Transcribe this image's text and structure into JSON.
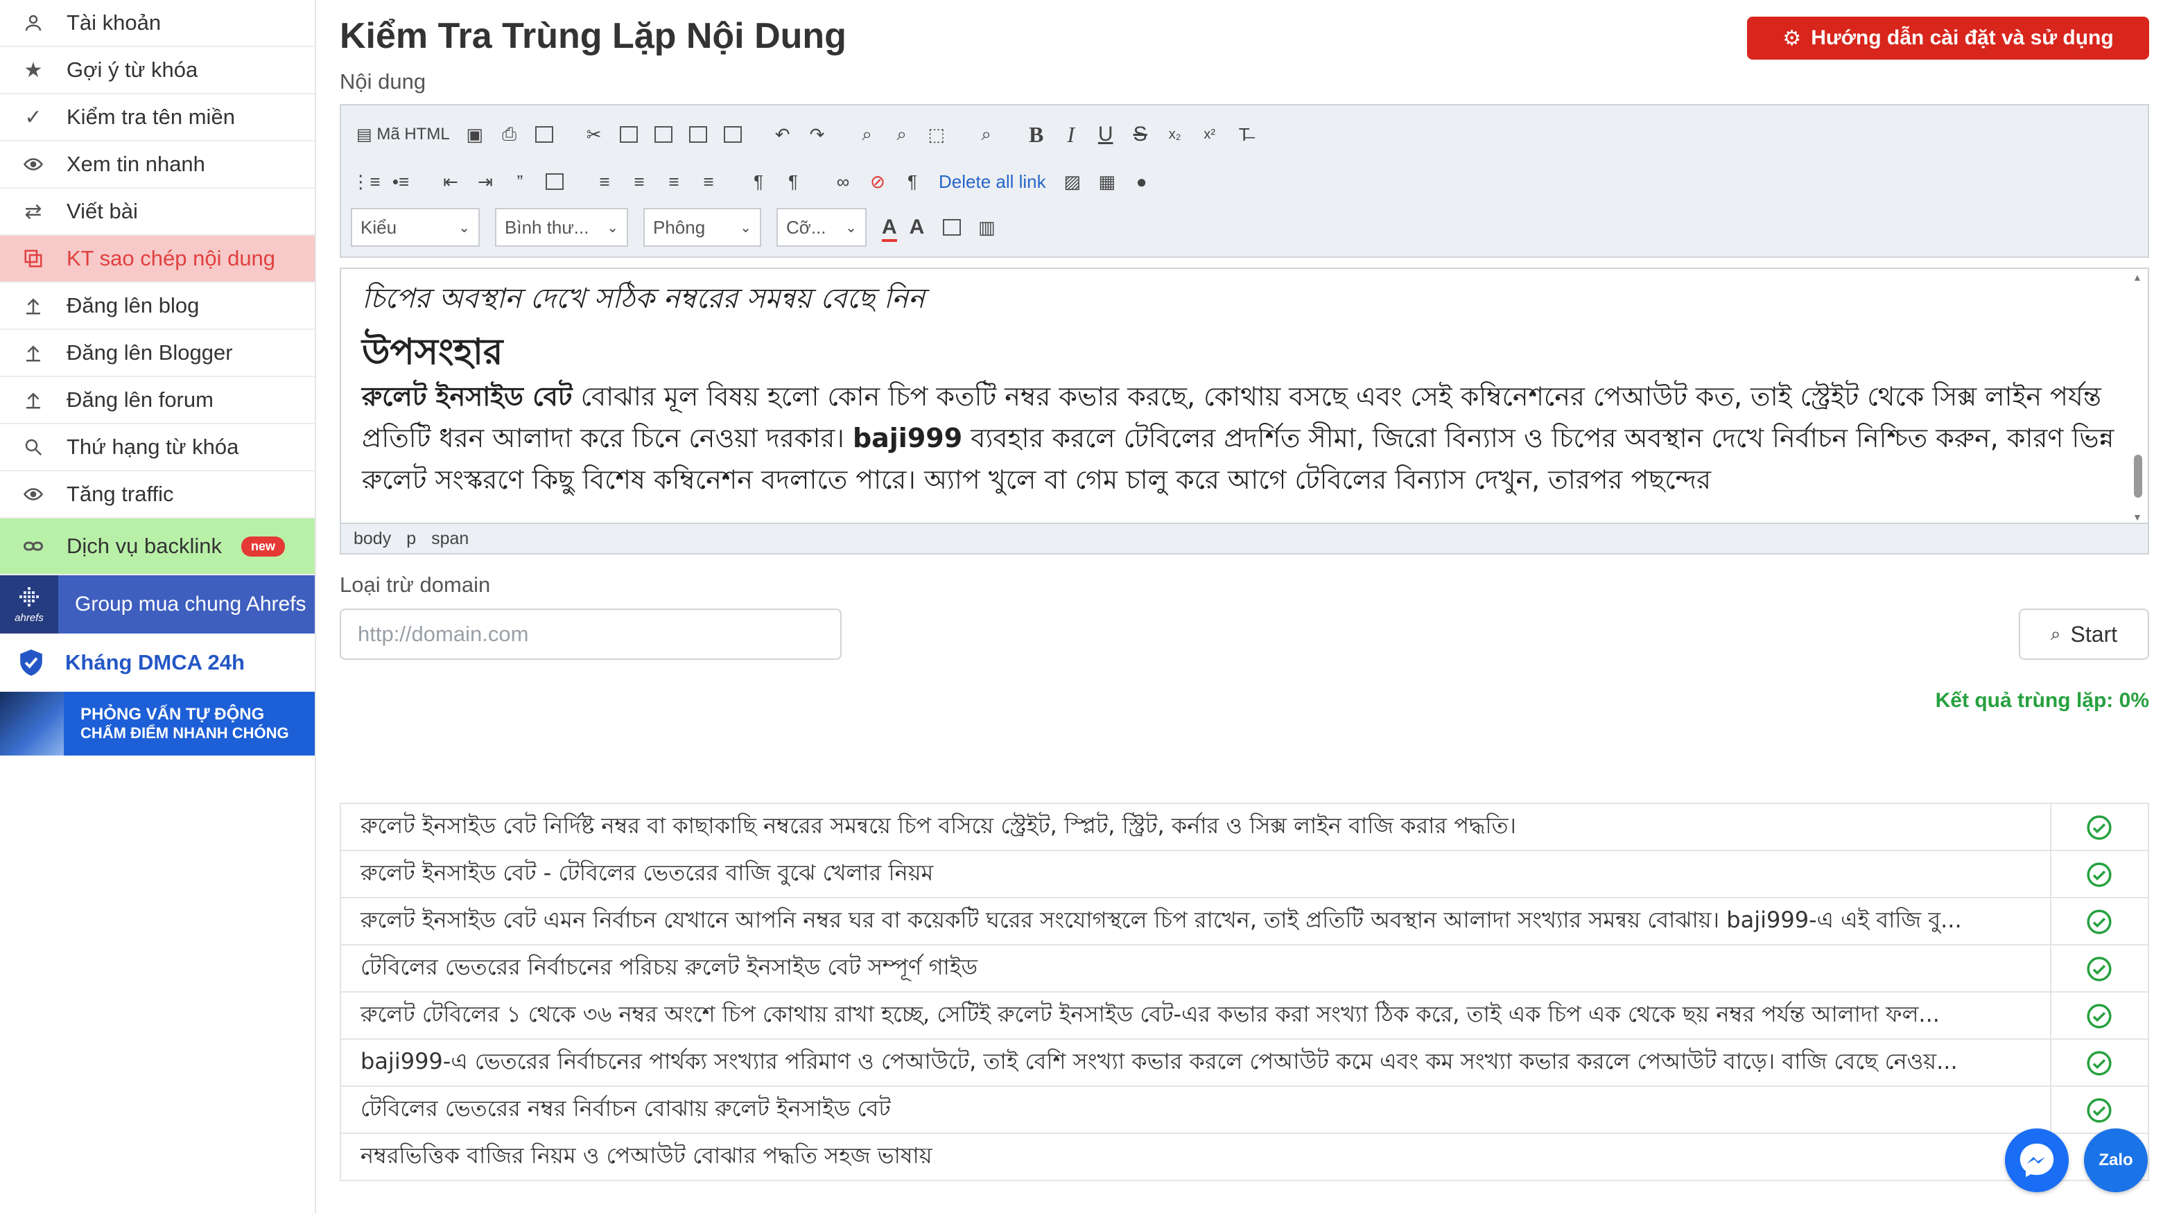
{
  "sidebar": {
    "items": [
      {
        "label": "Tài khoản",
        "icon": "user-icon"
      },
      {
        "label": "Gợi ý từ khóa",
        "icon": "star-icon"
      },
      {
        "label": "Kiểm tra tên miền",
        "icon": "check-icon"
      },
      {
        "label": "Xem tin nhanh",
        "icon": "eye-icon"
      },
      {
        "label": "Viết bài",
        "icon": "swap-icon"
      },
      {
        "label": "KT sao chép nội dung",
        "icon": "copy-icon",
        "active": true
      },
      {
        "label": "Đăng lên blog",
        "icon": "upload-icon"
      },
      {
        "label": "Đăng lên Blogger",
        "icon": "upload-icon"
      },
      {
        "label": "Đăng lên forum",
        "icon": "upload-icon"
      },
      {
        "label": "Thứ hạng từ khóa",
        "icon": "search-icon"
      },
      {
        "label": "Tăng traffic",
        "icon": "eye-icon"
      }
    ],
    "backlink": {
      "label": "Dịch vụ backlink",
      "badge": "new",
      "icon": "link-icon"
    },
    "ahrefs": {
      "logo_text": "ahrefs",
      "label": "Group mua chung Ahrefs"
    },
    "dmca": {
      "label": "Kháng DMCA 24h"
    },
    "interview": {
      "line1": "PHỎNG VẤN TỰ ĐỘNG",
      "line2": "CHẤM ĐIỂM NHANH CHÓNG"
    }
  },
  "header": {
    "title": "Kiểm Tra Trùng Lặp Nội Dung",
    "guide_button": "Hướng dẫn cài đặt và sử dụng"
  },
  "editor": {
    "label": "Nội dung",
    "toolbar": {
      "source_label": "Mã HTML",
      "delete_links_label": "Delete all link",
      "format_select": "Kiểu",
      "paragraph_select": "Bình thư...",
      "font_select": "Phông",
      "size_select": "Cỡ..."
    },
    "content": {
      "line1": "চিপের অবস্থান দেখে সঠিক নম্বরের সমন্বয় বেছে নিন",
      "heading": "উপসংহার",
      "para_bold": "রুলেট ইনসাইড বেট",
      "para_rest": " বোঝার মূল বিষয় হলো কোন চিপ কতটি নম্বর কভার করছে, কোথায় বসছে এবং সেই কম্বিনেশনের পেআউট কত, তাই স্ট্রেইট থেকে সিক্স লাইন পর্যন্ত প্রতিটি ধরন আলাদা করে চিনে নেওয়া দরকার। ",
      "para_bold2": "baji999",
      "para_rest2": " ব্যবহার করলে টেবিলের প্রদর্শিত সীমা, জিরো বিন্যাস ও চিপের অবস্থান দেখে নির্বাচন নিশ্চিত করুন, কারণ ভিন্ন রুলেট সংস্করণে কিছু বিশেষ কম্বিনেশন বদলাতে পারে। অ্যাপ খুলে বা গেম চালু করে আগে টেবিলের বিন্যাস দেখুন, তারপর পছন্দের"
    },
    "path": [
      "body",
      "p",
      "span"
    ]
  },
  "exclude": {
    "label": "Loại trừ domain",
    "placeholder": "http://domain.com",
    "start_button": "Start"
  },
  "result": {
    "text": "Kết quả trùng lặp: 0%"
  },
  "results": [
    {
      "text": "রুলেট ইনসাইড বেট নির্দিষ্ট নম্বর বা কাছাকাছি নম্বরের সমন্বয়ে চিপ বসিয়ে স্ট্রেইট, স্প্লিট, স্ট্রিট, কর্নার ও সিক্স লাইন বাজি করার পদ্ধতি।",
      "ok": true
    },
    {
      "text": "রুলেট ইনসাইড বেট - টেবিলের ভেতরের বাজি বুঝে খেলার নিয়ম",
      "ok": true
    },
    {
      "text": "রুলেট ইনসাইড বেট এমন নির্বাচন যেখানে আপনি নম্বর ঘর বা কয়েকটি ঘরের সংযোগস্থলে চিপ রাখেন, তাই প্রতিটি অবস্থান আলাদা সংখ্যার সমন্বয় বোঝায়। baji999-এ এই বাজি বু...",
      "ok": true
    },
    {
      "text": "টেবিলের ভেতরের নির্বাচনের পরিচয় রুলেট ইনসাইড বেট সম্পূর্ণ গাইড",
      "ok": true
    },
    {
      "text": "রুলেট টেবিলের ১ থেকে ৩৬ নম্বর অংশে চিপ কোথায় রাখা হচ্ছে, সেটিই রুলেট ইনসাইড বেট-এর কভার করা সংখ্যা ঠিক করে, তাই এক চিপ এক থেকে ছয় নম্বর পর্যন্ত আলাদা ফল...",
      "ok": true
    },
    {
      "text": "baji999-এ ভেতরের নির্বাচনের পার্থক্য সংখ্যার পরিমাণ ও পেআউটে, তাই বেশি সংখ্যা কভার করলে পেআউট কমে এবং কম সংখ্যা কভার করলে পেআউট বাড়ে। বাজি বেছে নেওয়...",
      "ok": true
    },
    {
      "text": "টেবিলের ভেতরের নম্বর নির্বাচন বোঝায় রুলেট ইনসাইড বেট",
      "ok": true
    },
    {
      "text": "নম্বরভিত্তিক বাজির নিয়ম ও পেআউট বোঝার পদ্ধতি সহজ ভাষায়",
      "ok": false
    }
  ],
  "floating": {
    "zalo_label": "Zalo"
  },
  "colors": {
    "accent_red": "#d8261c",
    "active_bg": "#f7c9c9",
    "backlink_bg": "#b9f0a8",
    "result_green": "#27a13f",
    "link_blue": "#2566c8"
  }
}
